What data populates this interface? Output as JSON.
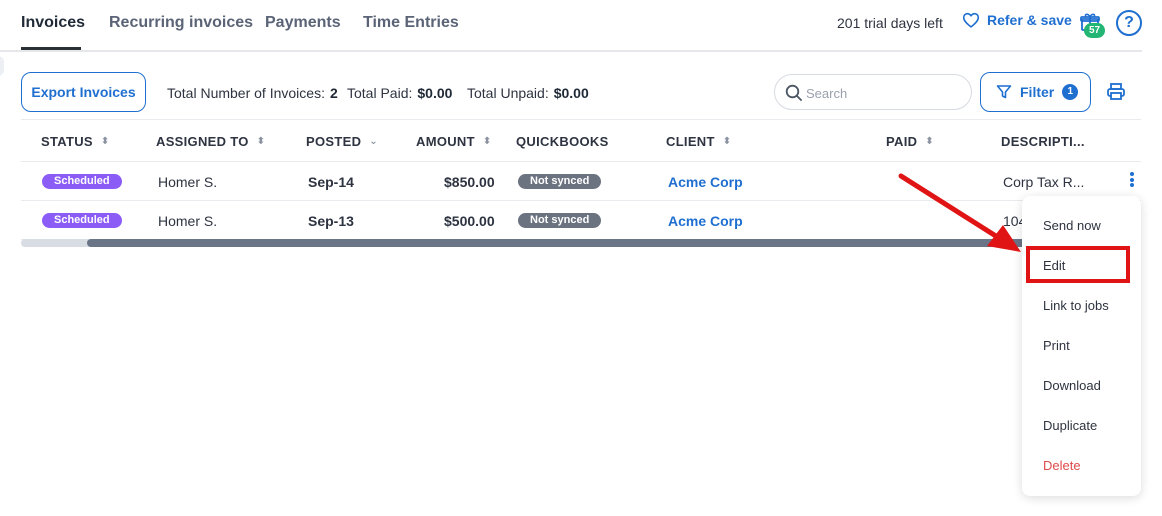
{
  "tabs": [
    {
      "label": "Invoices",
      "active": true
    },
    {
      "label": "Recurring invoices",
      "active": false
    },
    {
      "label": "Payments",
      "active": false
    },
    {
      "label": "Time Entries",
      "active": false
    }
  ],
  "header": {
    "trial_text": "201 trial days left",
    "refer_label": "Refer & save",
    "gift_count": "57",
    "help_label": "?"
  },
  "toolbar": {
    "export_label": "Export Invoices",
    "total_invoices_label": "Total Number of Invoices:",
    "total_invoices_value": "2",
    "total_paid_label": "Total Paid:",
    "total_paid_value": "$0.00",
    "total_unpaid_label": "Total Unpaid:",
    "total_unpaid_value": "$0.00",
    "search_placeholder": "Search",
    "filter_label": "Filter",
    "filter_count": "1"
  },
  "table": {
    "columns": [
      "STATUS",
      "ASSIGNED TO",
      "POSTED",
      "AMOUNT",
      "QUICKBOOKS",
      "CLIENT",
      "PAID",
      "DESCRIPTI..."
    ],
    "rows": [
      {
        "status": "Scheduled",
        "assigned": "Homer S.",
        "posted": "Sep-14",
        "amount": "$850.00",
        "quickbooks": "Not synced",
        "client": "Acme Corp",
        "paid": "",
        "description": "Corp Tax R..."
      },
      {
        "status": "Scheduled",
        "assigned": "Homer S.",
        "posted": "Sep-13",
        "amount": "$500.00",
        "quickbooks": "Not synced",
        "client": "Acme Corp",
        "paid": "",
        "description": "104"
      }
    ]
  },
  "menu": {
    "items": [
      "Send now",
      "Edit",
      "Link to jobs",
      "Print",
      "Download",
      "Duplicate",
      "Delete"
    ]
  },
  "colors": {
    "accent": "#1f6fd0",
    "status_scheduled": "#8b5cf6",
    "not_synced": "#6b7280",
    "annotation_red": "#e01414",
    "delete": "#e04b4b"
  }
}
